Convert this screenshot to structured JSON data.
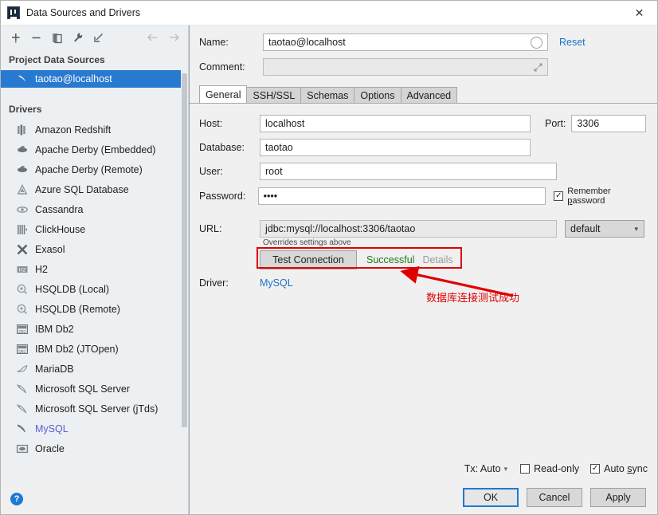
{
  "window": {
    "title": "Data Sources and Drivers",
    "app_icon": "datagrip-icon",
    "close_label": "✕"
  },
  "left_panel": {
    "toolbar": [
      {
        "name": "add-button",
        "icon": "plus-icon"
      },
      {
        "name": "remove-button",
        "icon": "minus-icon"
      },
      {
        "name": "duplicate-button",
        "icon": "copy-icon"
      },
      {
        "name": "properties-button",
        "icon": "wrench-icon"
      },
      {
        "name": "import-button",
        "icon": "import-arrow-icon"
      },
      {
        "name": "back-button",
        "icon": "arrow-left-icon"
      },
      {
        "name": "forward-button",
        "icon": "arrow-right-icon"
      }
    ],
    "project_sources_header": "Project Data Sources",
    "data_sources": [
      {
        "label": "taotao@localhost",
        "icon": "mysql-dolphin-icon",
        "selected": true
      }
    ],
    "drivers_header": "Drivers",
    "drivers": [
      {
        "label": "Amazon Redshift",
        "icon": "redshift-icon",
        "link": false
      },
      {
        "label": "Apache Derby (Embedded)",
        "icon": "derby-icon",
        "link": false
      },
      {
        "label": "Apache Derby (Remote)",
        "icon": "derby-icon",
        "link": false
      },
      {
        "label": "Azure SQL Database",
        "icon": "azure-icon",
        "link": false
      },
      {
        "label": "Cassandra",
        "icon": "cassandra-eye-icon",
        "link": false
      },
      {
        "label": "ClickHouse",
        "icon": "clickhouse-icon",
        "link": false
      },
      {
        "label": "Exasol",
        "icon": "exasol-x-icon",
        "link": false
      },
      {
        "label": "H2",
        "icon": "h2-icon",
        "link": false
      },
      {
        "label": "HSQLDB (Local)",
        "icon": "hsqldb-icon",
        "link": false
      },
      {
        "label": "HSQLDB (Remote)",
        "icon": "hsqldb-icon",
        "link": false
      },
      {
        "label": "IBM Db2",
        "icon": "db2-icon",
        "link": false
      },
      {
        "label": "IBM Db2 (JTOpen)",
        "icon": "db2-icon",
        "link": false
      },
      {
        "label": "MariaDB",
        "icon": "mariadb-icon",
        "link": false
      },
      {
        "label": "Microsoft SQL Server",
        "icon": "mssql-icon",
        "link": false
      },
      {
        "label": "Microsoft SQL Server (jTds)",
        "icon": "mssql-icon",
        "link": false
      },
      {
        "label": "MySQL",
        "icon": "mysql-dolphin-icon",
        "link": true
      },
      {
        "label": "Oracle",
        "icon": "oracle-icon",
        "link": false
      }
    ],
    "help_label": "?"
  },
  "form": {
    "name_label": "Name:",
    "name_value": "taotao@localhost",
    "comment_label": "Comment:",
    "comment_value": "",
    "reset_label": "Reset"
  },
  "tabs": [
    {
      "label": "General",
      "active": true
    },
    {
      "label": "SSH/SSL",
      "active": false
    },
    {
      "label": "Schemas",
      "active": false
    },
    {
      "label": "Options",
      "active": false
    },
    {
      "label": "Advanced",
      "active": false
    }
  ],
  "general": {
    "host_label": "Host:",
    "host_value": "localhost",
    "port_label": "Port:",
    "port_value": "3306",
    "database_label": "Database:",
    "database_value": "taotao",
    "user_label": "User:",
    "user_value": "root",
    "password_label": "Password:",
    "password_value": "••••",
    "remember_password_label": "Remember password",
    "remember_password_checked": true,
    "url_label": "URL:",
    "url_value": "jdbc:mysql://localhost:3306/taotao",
    "url_mode": "default",
    "overrides_note": "Overrides settings above",
    "test_connection_label": "Test Connection",
    "test_status": "Successful",
    "details_label": "Details",
    "driver_label": "Driver:",
    "driver_value": "MySQL"
  },
  "options_strip": {
    "tx_label": "Tx: Auto",
    "read_only_label": "Read-only",
    "read_only_checked": false,
    "auto_sync_label": "Auto sync",
    "auto_sync_checked": true
  },
  "footer": {
    "ok_label": "OK",
    "cancel_label": "Cancel",
    "apply_label": "Apply"
  },
  "annotation": {
    "text": "数据库连接测试成功",
    "color": "#e00000"
  },
  "colors": {
    "accent": "#2879d0",
    "link": "#1a73c8",
    "success": "#1f7a1f",
    "annotation": "#e00000",
    "selection": "#2879d0"
  }
}
